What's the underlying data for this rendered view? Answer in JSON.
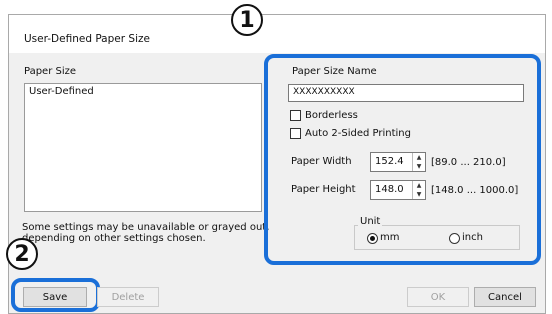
{
  "dialog": {
    "title": "User-Defined Paper Size"
  },
  "callouts": {
    "one": "1",
    "two": "2"
  },
  "left_panel": {
    "label": "Paper Size",
    "list_items": [
      "User-Defined"
    ],
    "note_line1": "Some settings may be unavailable or grayed out,",
    "note_line2": "depending on other settings chosen."
  },
  "right_panel": {
    "name_label": "Paper Size Name",
    "name_value": "XXXXXXXXXX",
    "borderless_label": "Borderless",
    "borderless_checked": false,
    "auto2sided_label": "Auto 2-Sided Printing",
    "auto2sided_checked": false,
    "width_label": "Paper Width",
    "width_value": "152.4",
    "width_range": "[89.0 ... 210.0]",
    "height_label": "Paper Height",
    "height_value": "148.0",
    "height_range": "[148.0 ... 1000.0]",
    "unit_label": "Unit",
    "unit_mm": "mm",
    "unit_inch": "inch",
    "unit_selected": "mm"
  },
  "buttons": {
    "save": "Save",
    "delete": "Delete",
    "ok": "OK",
    "cancel": "Cancel"
  },
  "colors": {
    "highlight": "#1a6fd8"
  }
}
